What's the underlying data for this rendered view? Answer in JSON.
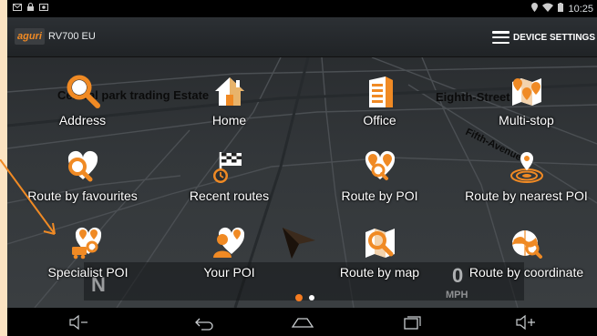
{
  "status_bar": {
    "time": "10:25"
  },
  "app": {
    "brand": "aguri",
    "model": "RV700 EU",
    "settings_label": "DEVICE SETTINGS"
  },
  "map": {
    "streets": [
      "Central park trading Estate",
      "Eighth-Street",
      "Fifth-Avenue"
    ],
    "heading_letter": "N",
    "speed_value": "0",
    "speed_unit": "MPH"
  },
  "menu": [
    {
      "label": "Address",
      "icon": "address-search-icon"
    },
    {
      "label": "Home",
      "icon": "home-icon"
    },
    {
      "label": "Office",
      "icon": "office-building-icon"
    },
    {
      "label": "Multi-stop",
      "icon": "multi-stop-map-icon"
    },
    {
      "label": "Route by favourites",
      "icon": "favourites-heart-icon"
    },
    {
      "label": "Recent routes",
      "icon": "recent-routes-flag-icon"
    },
    {
      "label": "Route by POI",
      "icon": "poi-pins-icon"
    },
    {
      "label": "Route by nearest POI",
      "icon": "nearest-poi-icon"
    },
    {
      "label": "Specialist POI",
      "icon": "specialist-poi-icon"
    },
    {
      "label": "Your POI",
      "icon": "your-poi-icon"
    },
    {
      "label": "Route by map",
      "icon": "map-search-icon"
    },
    {
      "label": "Route by coordinate",
      "icon": "globe-coordinate-icon"
    }
  ],
  "pager": {
    "pages": 2,
    "active": 1
  },
  "colors": {
    "accent": "#f47b20",
    "frame": "#fbe3c2"
  }
}
